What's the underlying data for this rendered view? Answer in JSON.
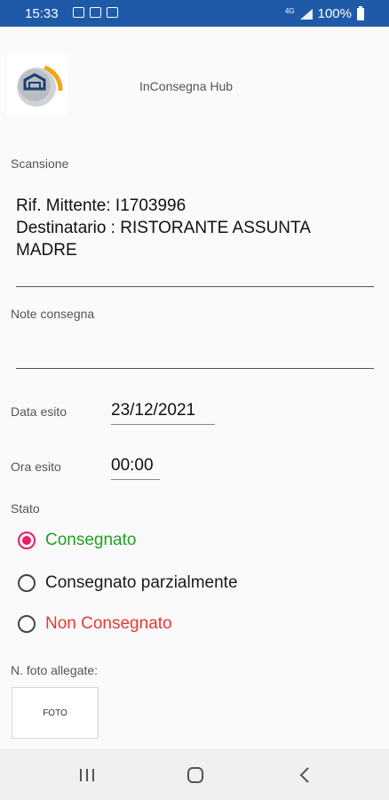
{
  "status_bar": {
    "time": "15:33",
    "network": "4G",
    "battery": "100%"
  },
  "header": {
    "title": "InConsegna Hub"
  },
  "scan": {
    "label": "Scansione",
    "lines": [
      "Rif. Mittente: I1703996",
      "Destinatario : RISTORANTE ASSUNTA",
      "MADRE"
    ]
  },
  "notes": {
    "label": "Note consegna",
    "value": ""
  },
  "date": {
    "label": "Data esito",
    "value": "23/12/2021"
  },
  "time": {
    "label": "Ora esito",
    "value": "00:00"
  },
  "status": {
    "label": "Stato",
    "selected": "Consegnato",
    "options": [
      {
        "label": "Consegnato",
        "color": "#22a022"
      },
      {
        "label": "Consegnato parzialmente",
        "color": "#111111"
      },
      {
        "label": "Non Consegnato",
        "color": "#e53935"
      }
    ]
  },
  "photos": {
    "label": "N. foto allegate:",
    "button_label": "FOTO"
  },
  "colors": {
    "status_bar": "#1e5aa8",
    "accent": "#e91e63"
  },
  "nav": {
    "icons": [
      "recent-apps-icon",
      "home-icon",
      "back-icon"
    ]
  }
}
